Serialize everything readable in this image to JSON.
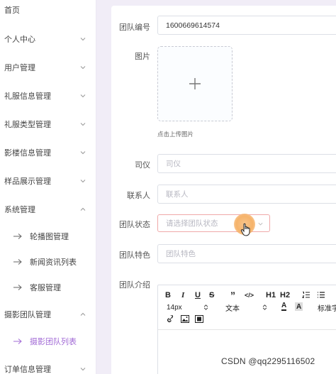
{
  "sidebar": {
    "items": [
      {
        "label": "首页"
      },
      {
        "label": "个人中心"
      },
      {
        "label": "用户管理"
      },
      {
        "label": "礼服信息管理"
      },
      {
        "label": "礼服类型管理"
      },
      {
        "label": "影楼信息管理"
      },
      {
        "label": "样品展示管理"
      },
      {
        "label": "系统管理"
      },
      {
        "label": "轮播图管理"
      },
      {
        "label": "新闻资讯列表"
      },
      {
        "label": "客服管理"
      },
      {
        "label": "摄影团队管理"
      },
      {
        "label": "摄影团队列表"
      },
      {
        "label": "订单信息管理"
      }
    ],
    "active_color": "#a26bd6"
  },
  "form": {
    "team_no": {
      "label": "团队编号",
      "value": "1600669614574"
    },
    "image": {
      "label": "图片",
      "upload_tip": "点击上传图片"
    },
    "host": {
      "label": "司仪",
      "placeholder": "司仪"
    },
    "contact": {
      "label": "联系人",
      "placeholder": "联系人"
    },
    "status": {
      "label": "团队状态",
      "placeholder": "请选择团队状态"
    },
    "feature": {
      "label": "团队特色",
      "placeholder": "团队特色"
    },
    "intro": {
      "label": "团队介绍"
    }
  },
  "editor": {
    "toolbar": {
      "bold": "B",
      "italic": "I",
      "underline": "U",
      "strike": "S",
      "quote": "”",
      "code": "</>",
      "h1": "H1",
      "h2": "H2",
      "font_size": "14px",
      "font_family": "文本",
      "text_color": "A",
      "bg_color": "A",
      "heading": "标准字"
    }
  },
  "watermark": "CSDN @qq2295116502"
}
